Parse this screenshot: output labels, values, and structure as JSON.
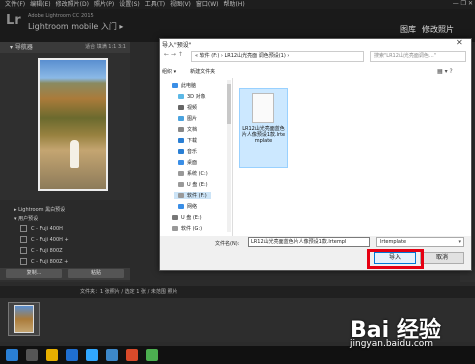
{
  "menubar": {
    "items": [
      "文件(F)",
      "编辑(E)",
      "修改照片(D)",
      "照片(P)",
      "设置(S)",
      "工具(T)",
      "视图(V)",
      "窗口(W)",
      "帮助(H)"
    ],
    "window_controls": "— ❐ ✕"
  },
  "lr": {
    "logo": "Lr",
    "title1": "Adobe Lightroom CC 2015",
    "title2": "Lightroom mobile 入门 ▸",
    "modules": [
      "图库",
      "修改照片"
    ]
  },
  "navigator": {
    "title": "▾ 导航器",
    "options": "适合  填满  1:1  3:1"
  },
  "presets": {
    "rows": [
      "▸ Lightroom 黑白预设",
      "▾ 用户预设",
      "C - Fuji 400H",
      "C - Fuji 400H +",
      "C - Fuji 800Z",
      "C - Fuji 800Z +"
    ]
  },
  "left_buttons": {
    "copy": "复制...",
    "paste": "粘贴"
  },
  "filmstrip": {
    "info": "文件夹：1 张照片 / 选定 1 张 / 未范围 照片"
  },
  "dialog": {
    "title": "导入\"预设\"",
    "close": "✕",
    "address": "« 软件 (F:)  ›  LR12山光亮面 调色预设(1)  ›",
    "search_placeholder": "搜索\"LR12山光亮面调色...\"",
    "toolbar": {
      "organize": "组织 ▾",
      "new_folder": "新建文件夹"
    },
    "sidebar": [
      {
        "label": "此电脑",
        "icon": "computer-icon"
      },
      {
        "label": "3D 对象",
        "icon": "cube-icon"
      },
      {
        "label": "视频",
        "icon": "video-icon"
      },
      {
        "label": "图片",
        "icon": "picture-icon"
      },
      {
        "label": "文档",
        "icon": "document-icon"
      },
      {
        "label": "下载",
        "icon": "download-icon"
      },
      {
        "label": "音乐",
        "icon": "music-icon"
      },
      {
        "label": "桌面",
        "icon": "desktop-icon"
      },
      {
        "label": "系统 (C:)",
        "icon": "drive-icon"
      },
      {
        "label": "U 盘 (E:)",
        "icon": "drive-icon"
      },
      {
        "label": "软件 (F:)",
        "icon": "drive-icon"
      },
      {
        "label": "网络",
        "icon": "network-icon"
      },
      {
        "label": "U 盘 (E:)",
        "icon": "usb-icon"
      },
      {
        "label": "软件 (G:)",
        "icon": "drive-icon"
      }
    ],
    "file": {
      "name": "LR12山光亮面蓝色片人像预设1款.lrtemplate"
    },
    "filename_label": "文件名(N):",
    "filename_value": "LR12山光亮面蓝色片人像预设1款.lrtempl",
    "filetype": "lrtemplate",
    "import_label": "导入",
    "cancel_label": "取消"
  },
  "watermark": {
    "text": "Bai 经验",
    "url": "jingyan.baidu.com"
  },
  "colors": {
    "highlight": "#e60012",
    "lr_dark": "#1a1a1a",
    "selection": "#cce8ff"
  }
}
